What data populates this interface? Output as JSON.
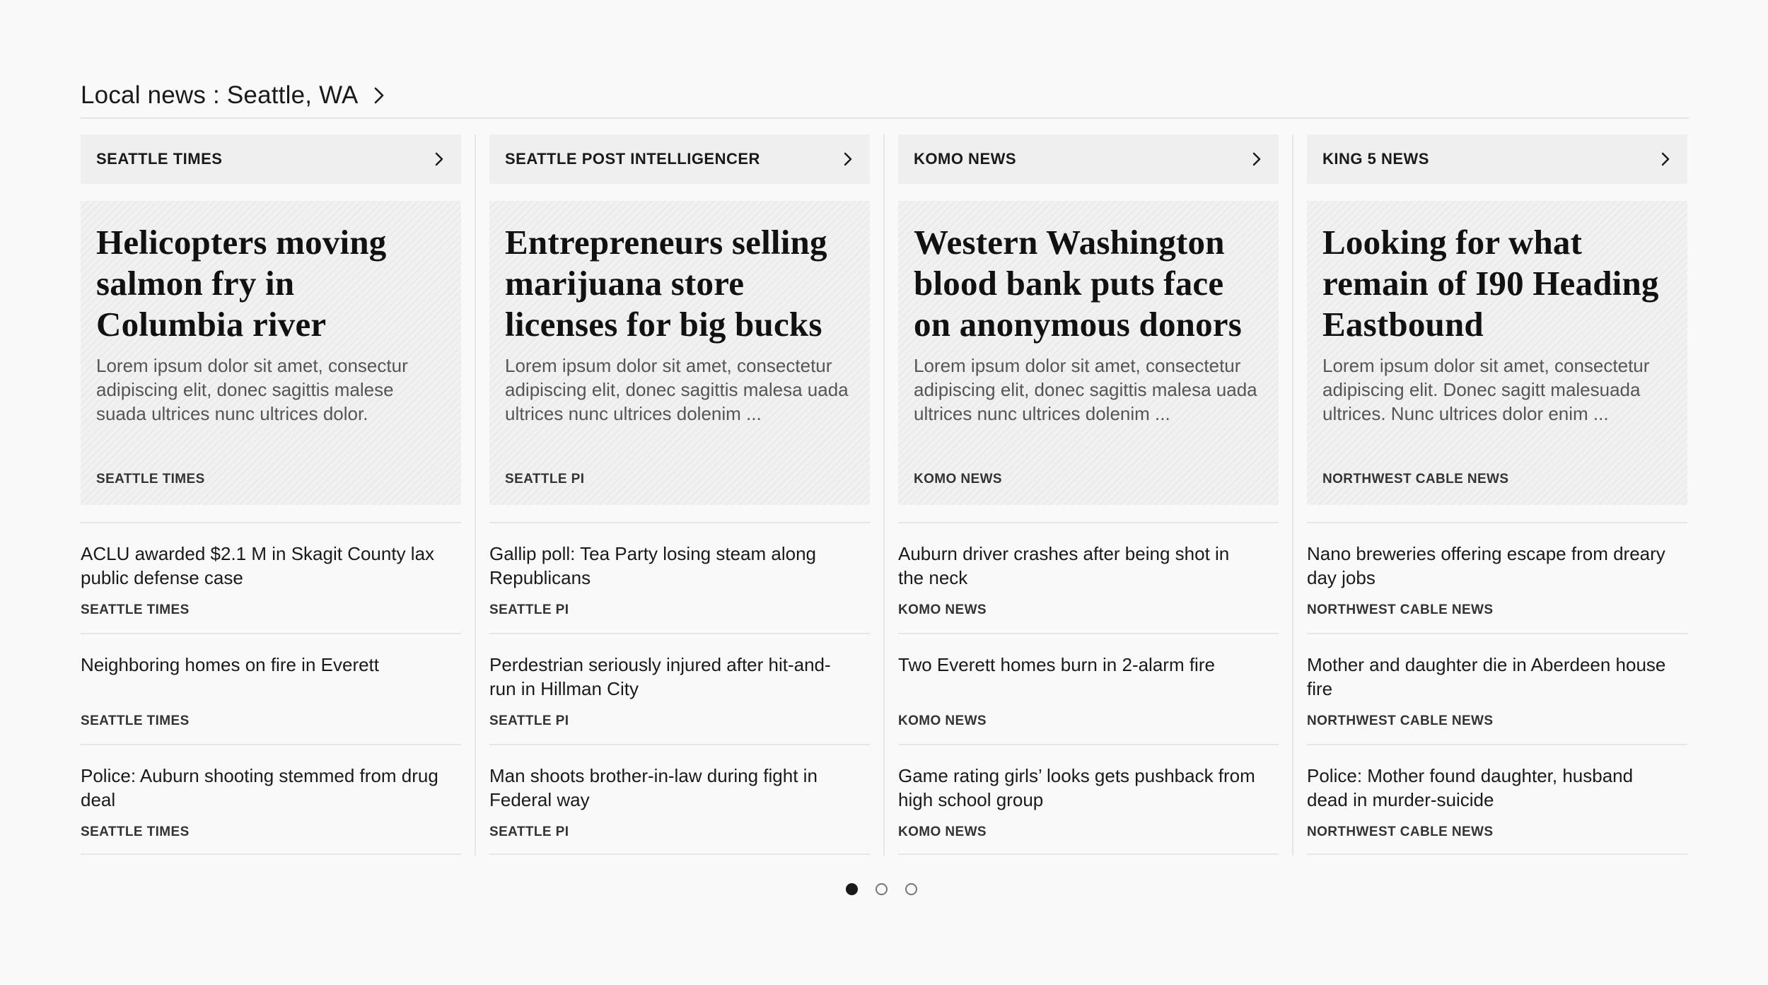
{
  "section": {
    "title": "Local news : Seattle, WA",
    "chevron_icon": "chevron-right-icon"
  },
  "columns": [
    {
      "source": "SEATTLE TIMES",
      "feature": {
        "headline": "Helicopters moving salmon fry in Columbia river",
        "description": "Lorem ipsum dolor sit amet, consectur adipiscing elit, donec sagittis malese suada ultrices nunc ultrices dolor.",
        "source": "SEATTLE TIMES"
      },
      "stories": [
        {
          "title": "ACLU awarded $2.1 M in Skagit County lax public defense case",
          "source": "SEATTLE TIMES"
        },
        {
          "title": "Neighboring homes on fire in Everett",
          "source": "SEATTLE TIMES"
        },
        {
          "title": "Police: Auburn shooting stemmed from drug deal",
          "source": "SEATTLE TIMES"
        }
      ]
    },
    {
      "source": "SEATTLE POST INTELLIGENCER",
      "feature": {
        "headline": "Entrepreneurs selling marijuana store licenses for big bucks",
        "description": "Lorem ipsum dolor sit amet, consectetur adipiscing elit, donec sagittis malesa uada ultrices nunc ultrices dolenim ...",
        "source": "SEATTLE PI"
      },
      "stories": [
        {
          "title": "Gallip poll: Tea Party losing steam along Republicans",
          "source": "SEATTLE PI"
        },
        {
          "title": "Perdestrian seriously injured after hit-and-run in Hillman City",
          "source": "SEATTLE PI"
        },
        {
          "title": "Man shoots brother-in-law during fight in Federal way",
          "source": "SEATTLE PI"
        }
      ]
    },
    {
      "source": "KOMO NEWS",
      "feature": {
        "headline": "Western Washington blood bank puts face on anonymous donors",
        "description": "Lorem ipsum dolor sit amet, consectetur adipiscing elit, donec sagittis malesa uada ultrices nunc ultrices dolenim ...",
        "source": "KOMO NEWS"
      },
      "stories": [
        {
          "title": "Auburn driver crashes after being shot in the neck",
          "source": "KOMO NEWS"
        },
        {
          "title": "Two Everett homes burn in 2-alarm fire",
          "source": "KOMO NEWS"
        },
        {
          "title": "Game rating girls’ looks gets pushback from high school group",
          "source": "KOMO NEWS"
        }
      ]
    },
    {
      "source": "KING 5 NEWS",
      "feature": {
        "headline": "Looking for what remain of I90 Heading Eastbound",
        "description": "Lorem ipsum dolor sit amet, consectetur adipiscing elit. Donec sagitt malesuada ultrices. Nunc ultrices dolor enim ...",
        "source": "NORTHWEST CABLE NEWS"
      },
      "stories": [
        {
          "title": "Nano breweries offering escape from dreary day jobs",
          "source": "NORTHWEST CABLE NEWS"
        },
        {
          "title": "Mother and daughter die in Aberdeen house fire",
          "source": "NORTHWEST CABLE NEWS"
        },
        {
          "title": "Police: Mother found daughter, husband dead in murder-suicide",
          "source": "NORTHWEST CABLE NEWS"
        }
      ]
    }
  ],
  "pager": {
    "pages": 3,
    "active": 1
  }
}
